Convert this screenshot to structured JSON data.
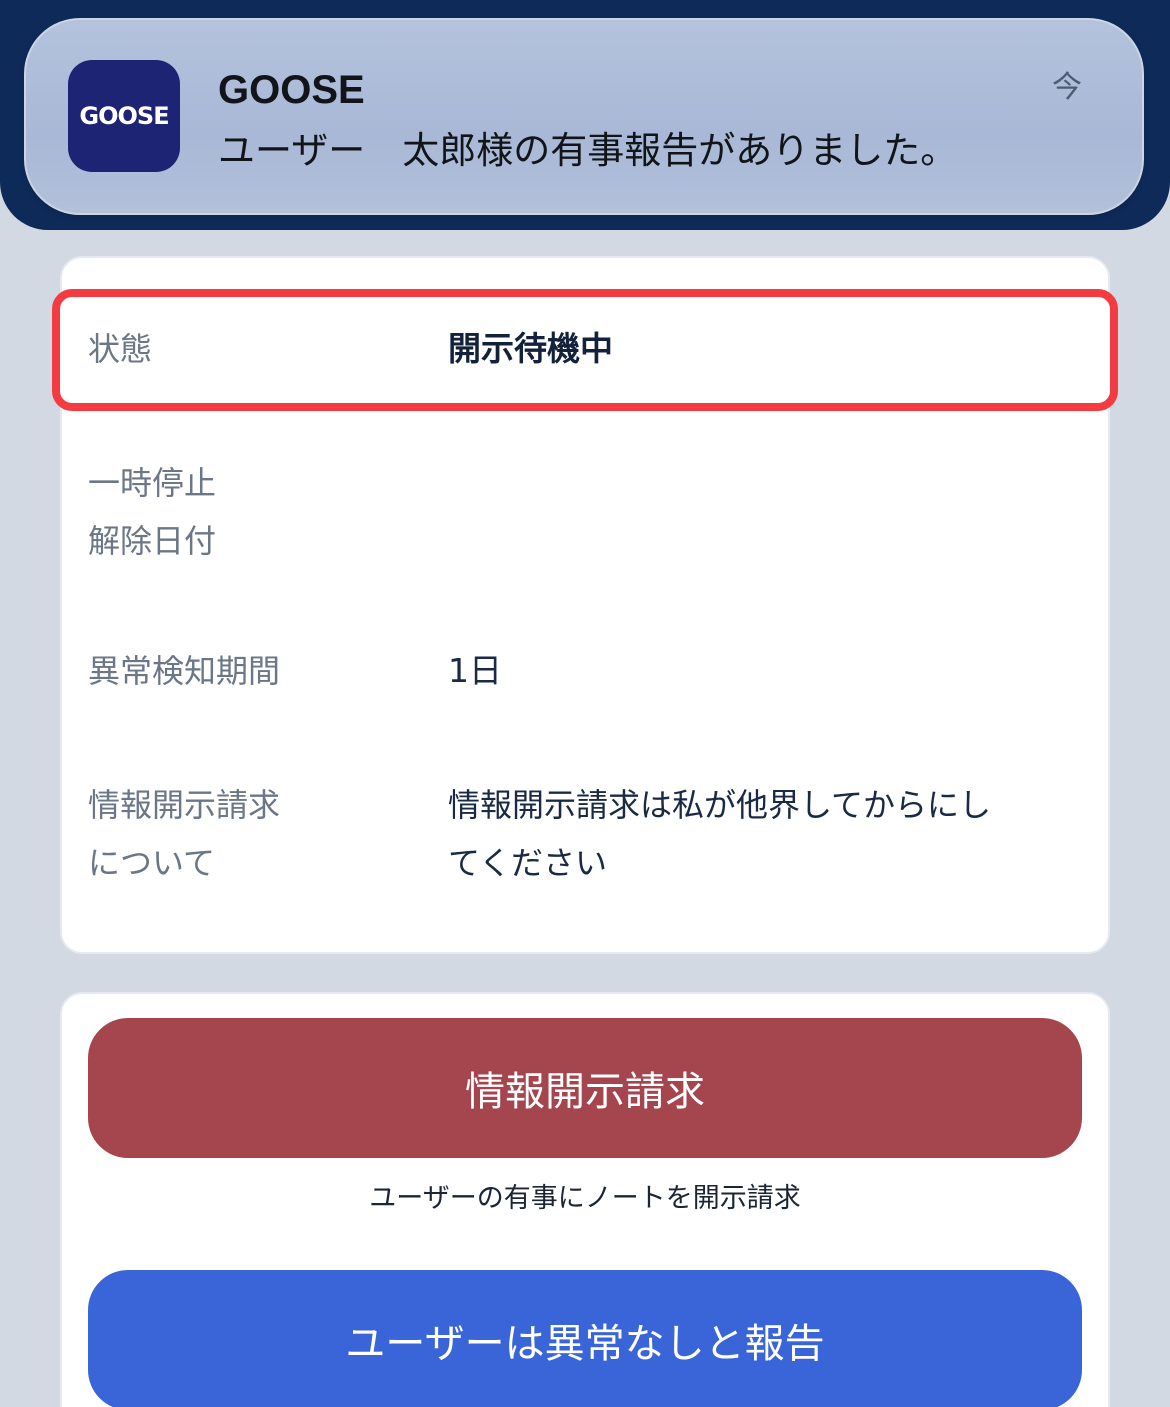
{
  "notification": {
    "app_icon_text": "GOOSE",
    "app_name": "GOOSE",
    "message": "ユーザー　太郎様の有事報告がありました。",
    "time": "今"
  },
  "info": {
    "status_label": "状態",
    "status_value": "開示待機中",
    "pause_label_line1": "一時停止",
    "pause_label_line2": "解除日付",
    "pause_value": "",
    "detection_label": "異常検知期間",
    "detection_value": "1日",
    "disclosure_label_line1": "情報開示請求",
    "disclosure_label_line2": "について",
    "disclosure_value_line1": "情報開示請求は私が他界してからにし",
    "disclosure_value_line2": "てください"
  },
  "actions": {
    "disclose_button": "情報開示請求",
    "disclose_caption": "ユーザーの有事にノートを開示請求",
    "normal_button": "ユーザーは異常なしと報告"
  },
  "colors": {
    "banner": "#0e2a58",
    "highlight": "#f43b41",
    "disclose": "#a5454d",
    "normal": "#3a65d8"
  }
}
